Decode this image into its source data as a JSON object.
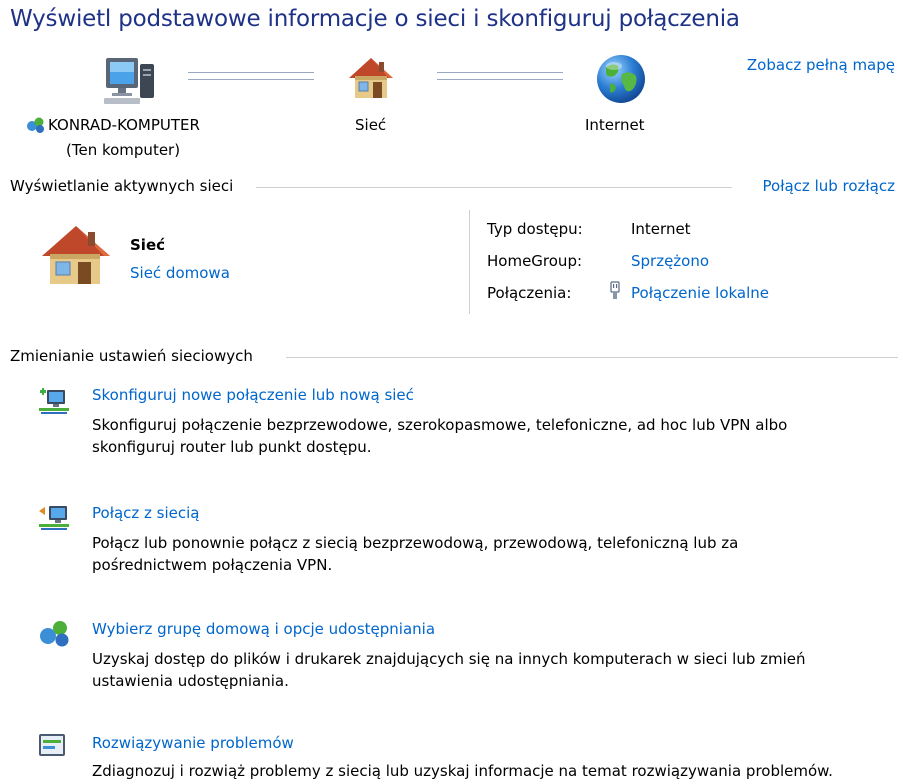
{
  "page_title": "Wyświetl podstawowe informacje o sieci i skonfiguruj połączenia",
  "map": {
    "full_map_link": "Zobacz pełną mapę",
    "computer_name": "KONRAD-KOMPUTER",
    "computer_sub": "(Ten komputer)",
    "network_label": "Sieć",
    "internet_label": "Internet"
  },
  "active_networks": {
    "heading": "Wyświetlanie aktywnych sieci",
    "connect_link": "Połącz lub rozłącz",
    "network_name": "Sieć",
    "network_type": "Sieć domowa",
    "access_type_label": "Typ dostępu:",
    "access_type_value": "Internet",
    "homegroup_label": "HomeGroup:",
    "homegroup_value": "Sprzężono",
    "connections_label": "Połączenia:",
    "connections_value": "Połączenie lokalne"
  },
  "change_settings": {
    "heading": "Zmienianie ustawień sieciowych",
    "tasks": [
      {
        "title": "Skonfiguruj nowe połączenie lub nową sieć",
        "desc1": "Skonfiguruj połączenie bezprzewodowe, szerokopasmowe, telefoniczne, ad hoc lub VPN albo",
        "desc2": "skonfiguruj router lub punkt dostępu."
      },
      {
        "title": "Połącz z siecią",
        "desc1": "Połącz lub ponownie połącz z siecią bezprzewodową, przewodową, telefoniczną lub za",
        "desc2": "pośrednictwem połączenia VPN."
      },
      {
        "title": "Wybierz grupę domową i opcje udostępniania",
        "desc1": "Uzyskaj dostęp do plików i drukarek znajdujących się na innych komputerach w sieci lub zmień",
        "desc2": "ustawienia udostępniania."
      },
      {
        "title": "Rozwiązywanie problemów",
        "desc1": "Zdiagnozuj i rozwiąż problemy z siecią lub uzyskaj informacje na temat rozwiązywania problemów.",
        "desc2": ""
      }
    ]
  },
  "colors": {
    "title": "#1e3287",
    "link": "#0066cc",
    "rule": "#d0d0d0"
  }
}
